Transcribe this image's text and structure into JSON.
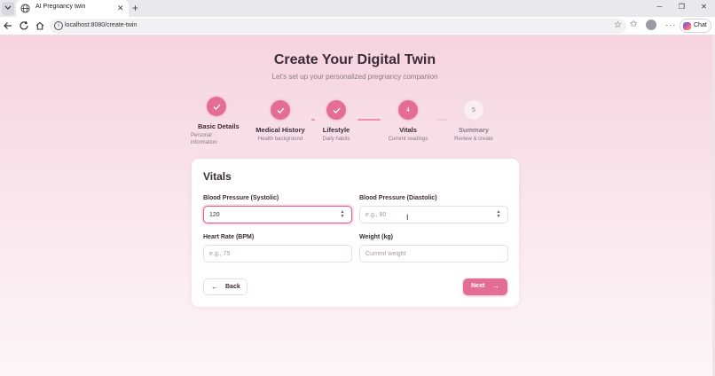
{
  "browser": {
    "tab_title": "AI Pregnancy twin",
    "tab_close": "✕",
    "new_tab": "+",
    "url": "localhost:8080/create-twin",
    "chat_label": "Chat",
    "icons": {
      "tab_menu": "chevron-down-icon",
      "tab_favicon": "globe-icon",
      "back": "arrow-left-icon",
      "reload": "reload-icon",
      "home": "home-icon",
      "site_info": "info-icon",
      "favorite": "star-icon",
      "favorites": "favorites-icon",
      "profile": "avatar",
      "more": "more-icon",
      "copilot": "copilot-icon"
    }
  },
  "header": {
    "title": "Create Your Digital Twin",
    "subtitle": "Let's set up your personalized pregnancy companion"
  },
  "steps": [
    {
      "label": "Basic Details",
      "sub": "Personal information",
      "state": "done"
    },
    {
      "label": "Medical History",
      "sub": "Health background",
      "state": "done"
    },
    {
      "label": "Lifestyle",
      "sub": "Daily habits",
      "state": "done"
    },
    {
      "label": "Vitals",
      "sub": "Current readings",
      "state": "active",
      "number": "4"
    },
    {
      "label": "Summary",
      "sub": "Review & create",
      "state": "pending",
      "number": "5"
    }
  ],
  "form": {
    "title": "Vitals",
    "fields": {
      "systolic": {
        "label": "Blood Pressure (Systolic)",
        "value": "120",
        "placeholder": ""
      },
      "diastolic": {
        "label": "Blood Pressure (Diastolic)",
        "value": "",
        "placeholder": "e.g., 80"
      },
      "heart_rate": {
        "label": "Heart Rate (BPM)",
        "value": "",
        "placeholder": "e.g., 75"
      },
      "weight": {
        "label": "Weight (kg)",
        "value": "",
        "placeholder": "Current weight"
      }
    },
    "back_label": "Back",
    "next_label": "Next"
  },
  "colors": {
    "accent": "#e46d96",
    "title": "#3a2b34",
    "muted": "#8c7a84",
    "background": "#f6dbe5"
  }
}
